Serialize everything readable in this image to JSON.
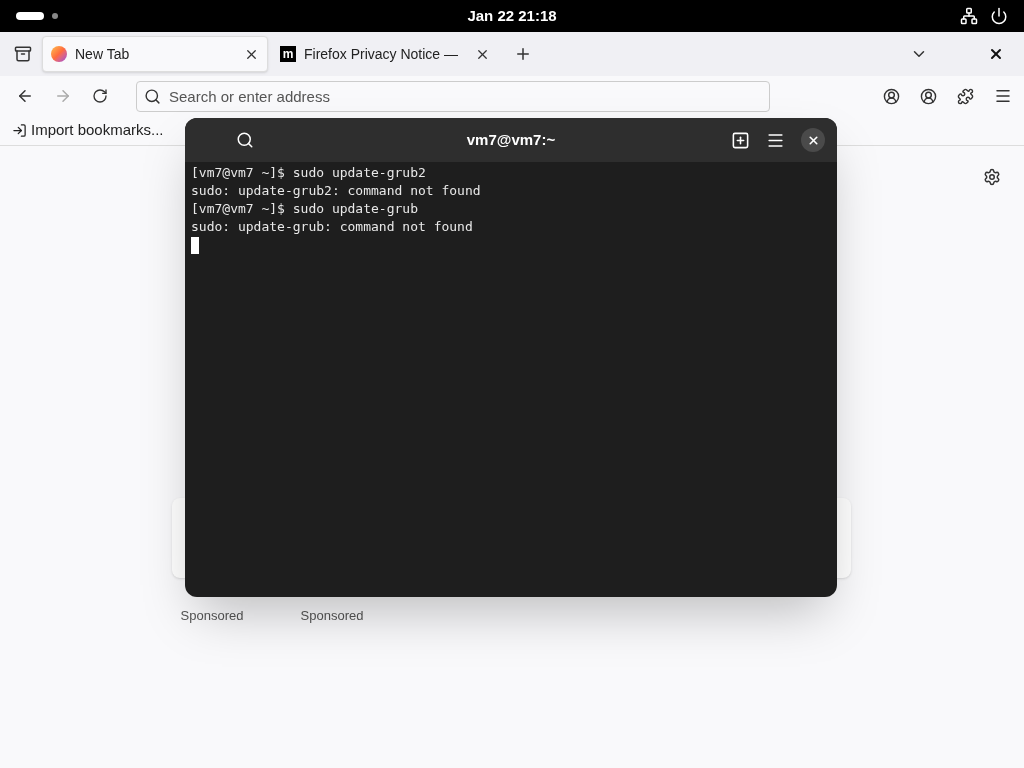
{
  "top_bar": {
    "clock": "Jan 22  21:18"
  },
  "tabs": [
    {
      "title": "New Tab",
      "kind": "firefox",
      "selected": true
    },
    {
      "title": "Firefox Privacy Notice —",
      "kind": "letter",
      "favicon_text": "m",
      "selected": false
    }
  ],
  "address_bar": {
    "placeholder": "Search or enter address"
  },
  "bookmarks": [
    {
      "label": "Import bookmarks..."
    }
  ],
  "shortcuts": [
    {
      "sponsored": "Sponsored"
    },
    {
      "sponsored": "Sponsored"
    }
  ],
  "terminal": {
    "title": "vm7@vm7:~",
    "lines": [
      "[vm7@vm7 ~]$ sudo update-grub2",
      "sudo: update-grub2: command not found",
      "[vm7@vm7 ~]$ sudo update-grub",
      "sudo: update-grub: command not found"
    ]
  }
}
